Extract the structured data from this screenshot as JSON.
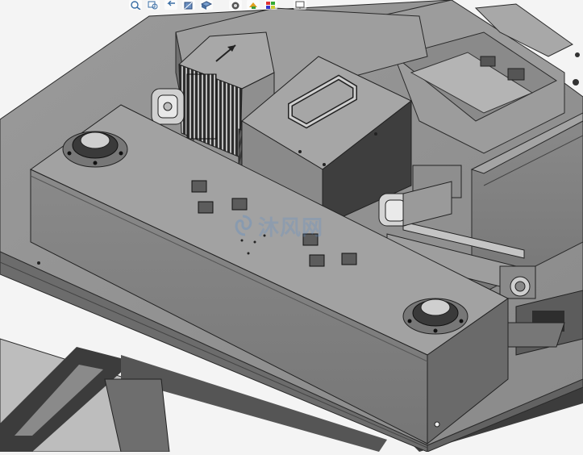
{
  "colors": {
    "background": "#f4f4f4",
    "plate": "#8e8e8e",
    "enclosure_side": "#7e7e7e",
    "enclosure_top": "#a0a0a0",
    "frame": "#6a6a6a",
    "watermark": "#5a8cc8"
  },
  "toolbar": {
    "icons": [
      "zoom-to-fit-icon",
      "zoom-area-icon",
      "previous-view-icon",
      "section-view-icon",
      "view-orientation-icon",
      "display-style-icon",
      "hide-show-icon",
      "edit-appearance-icon",
      "apply-scene-icon",
      "view-settings-icon"
    ]
  },
  "watermark": {
    "text": "沐风网",
    "icon": "watermark-logo-icon"
  }
}
